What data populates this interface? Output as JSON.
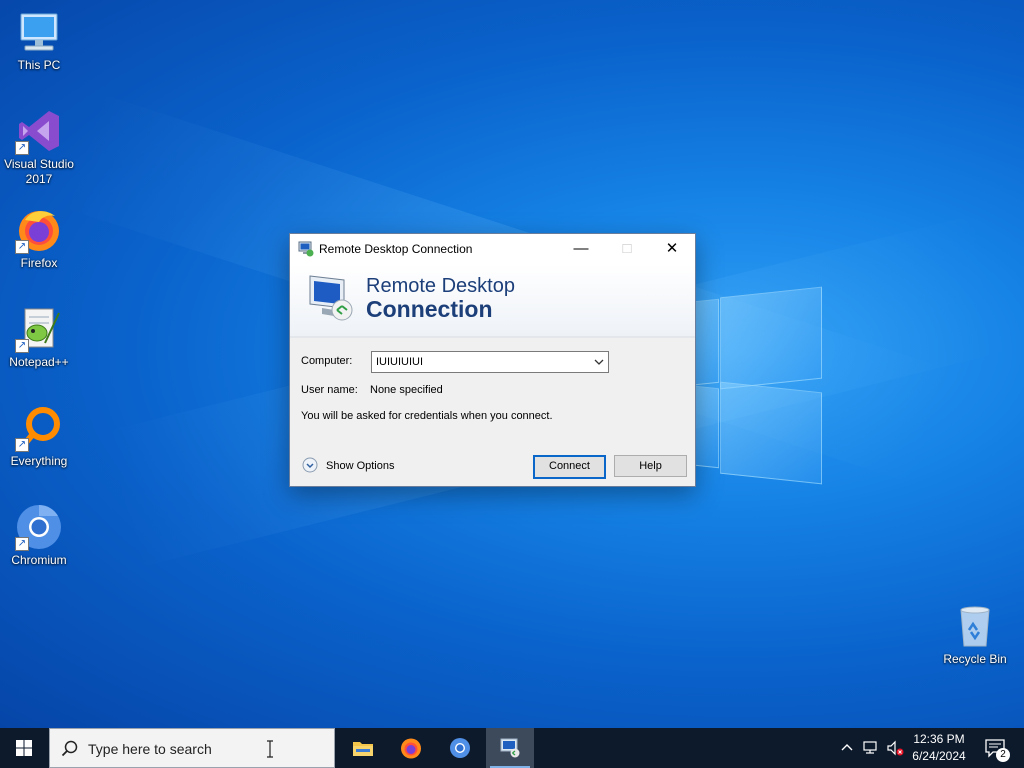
{
  "desktop_icons": [
    {
      "label": "This PC",
      "icon": "this-pc-icon"
    },
    {
      "label": "Visual Studio 2017",
      "icon": "visual-studio-icon"
    },
    {
      "label": "Firefox",
      "icon": "firefox-icon"
    },
    {
      "label": "Notepad++",
      "icon": "notepadpp-icon"
    },
    {
      "label": "Everything",
      "icon": "everything-icon"
    },
    {
      "label": "Chromium",
      "icon": "chromium-icon"
    },
    {
      "label": "Recycle Bin",
      "icon": "recycle-bin-icon"
    }
  ],
  "rdp_window": {
    "title": "Remote Desktop Connection",
    "banner_line1": "Remote Desktop",
    "banner_line2": "Connection",
    "computer_label": "Computer:",
    "computer_value": "IUIUIUIUI",
    "username_label": "User name:",
    "username_value": "None specified",
    "info_text": "You will be asked for credentials when you connect.",
    "show_options": "Show Options",
    "connect_button": "Connect",
    "help_button": "Help"
  },
  "taskbar": {
    "search_placeholder": "Type here to search",
    "apps": [
      "file-explorer-icon",
      "firefox-icon",
      "chromium-icon",
      "remote-desktop-icon"
    ],
    "active_app": "remote-desktop-icon",
    "time": "12:36 PM",
    "date": "6/24/2024",
    "notification_count": "2"
  },
  "colors": {
    "desktop_blue": "#0a63cc",
    "taskbar": "#0d1a2b",
    "banner_text": "#1c3f7a",
    "default_button_border": "#0a66c8"
  }
}
